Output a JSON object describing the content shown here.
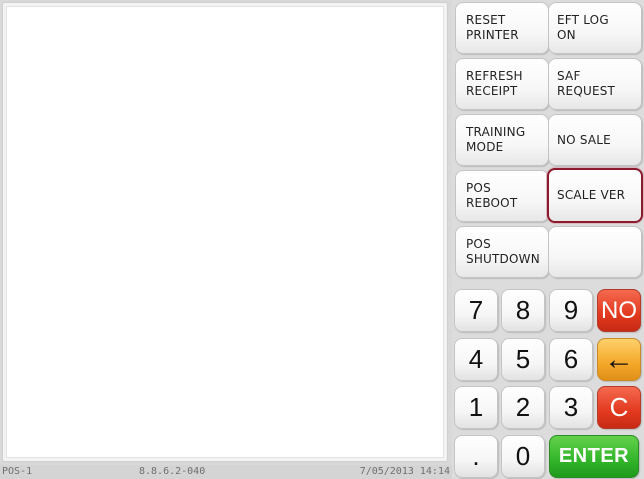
{
  "status_bar": {
    "terminal": "POS-1",
    "version": "8.8.6.2-040",
    "datetime": "7/05/2013 14:14"
  },
  "function_buttons": {
    "reset_printer": "RESET\nPRINTER",
    "eft_log_on": "EFT LOG\nON",
    "refresh_receipt": "REFRESH\nRECEIPT",
    "saf_request": "SAF\nREQUEST",
    "training_mode": "TRAINING\nMODE",
    "no_sale": "NO SALE",
    "pos_reboot": "POS\nREBOOT",
    "scale_ver": "SCALE VER",
    "pos_shutdown": "POS\nSHUTDOWN",
    "blank": ""
  },
  "keypad": {
    "k7": "7",
    "k8": "8",
    "k9": "9",
    "no": "NO",
    "k4": "4",
    "k5": "5",
    "k6": "6",
    "back": "←",
    "k1": "1",
    "k2": "2",
    "k3": "3",
    "clear": "C",
    "dot": ".",
    "k0": "0",
    "enter": "ENTER"
  },
  "colors": {
    "highlight_border": "#8a1a2c",
    "no_key": "#e2391f",
    "back_key": "#f4a829",
    "clear_key": "#e2391f",
    "enter_key": "#32b52a"
  },
  "icons": {
    "back": "left-arrow-icon"
  }
}
